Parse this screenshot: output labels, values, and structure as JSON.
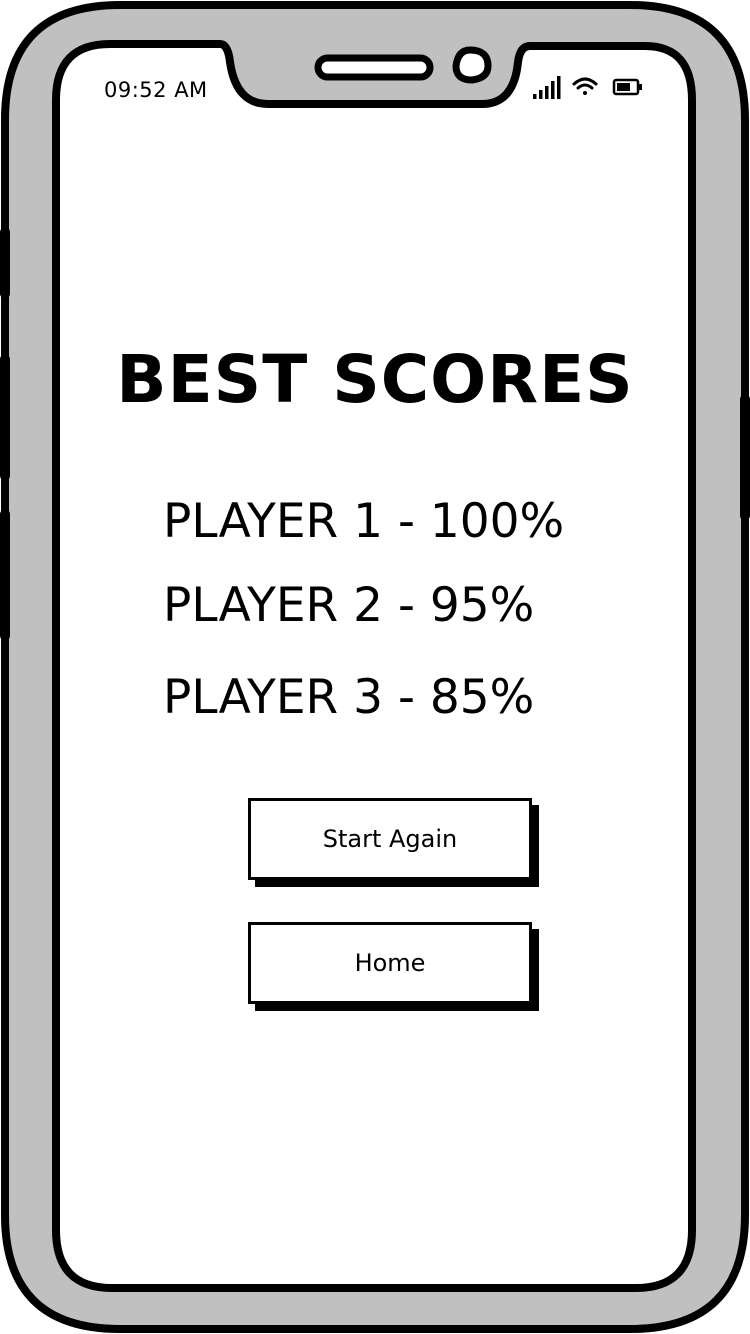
{
  "status_bar": {
    "time": "09:52 AM",
    "icons": [
      "signal-icon",
      "wifi-icon",
      "battery-icon"
    ]
  },
  "screen": {
    "title": "BEST SCORES",
    "scores": [
      "PLAYER 1 - 100%",
      "PLAYER 2 - 95%",
      "PLAYER 3 - 85%"
    ],
    "buttons": {
      "start_again": "Start Again",
      "home": "Home"
    }
  },
  "colors": {
    "frame": "#c0c0c0",
    "outline": "#000000",
    "screen": "#ffffff"
  }
}
